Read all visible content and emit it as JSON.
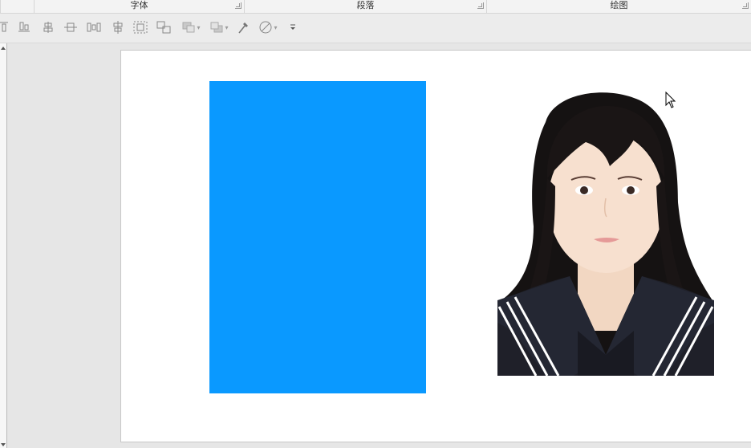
{
  "ribbon": {
    "groups": [
      {
        "label": "字体"
      },
      {
        "label": "段落"
      },
      {
        "label": "绘图"
      }
    ]
  },
  "toolbar": {
    "icons": [
      "align-top-icon",
      "align-bottom-icon",
      "align-center-vertical-icon",
      "distribute-horizontal-icon",
      "distribute-columns-icon",
      "align-middle-icon",
      "group-icon",
      "ungroup-icon",
      "bring-forward-icon",
      "send-backward-icon",
      "eyedropper-icon",
      "shape-effects-icon",
      "more-options-icon"
    ]
  },
  "slide": {
    "rectangle_color": "#0a99ff",
    "photo": "id-photo-girl-sailor-uniform"
  },
  "colors": {
    "accent_blue": "#0a99ff",
    "ribbon_bg": "#f3f3f3",
    "workspace_bg": "#e6e6e6"
  }
}
